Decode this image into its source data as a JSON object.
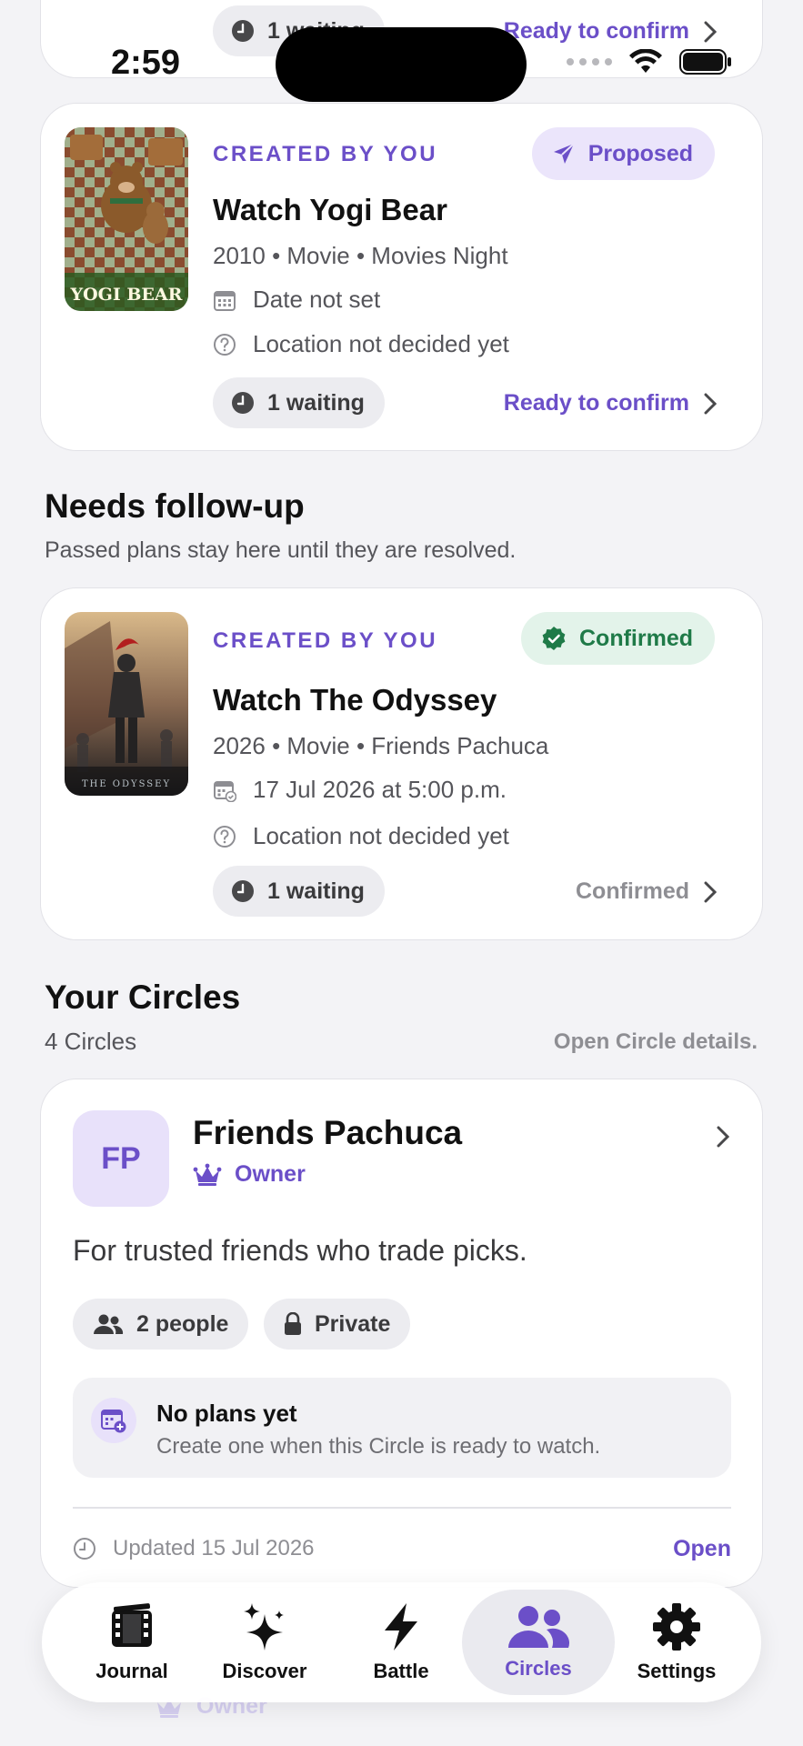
{
  "status_bar": {
    "time": "2:59"
  },
  "top_partial_card": {
    "waiting": "1 waiting",
    "action": "Ready to confirm"
  },
  "plan_yogi": {
    "created": "CREATED BY YOU",
    "status": "Proposed",
    "title": "Watch Yogi Bear",
    "meta": "2010 • Movie • Movies Night",
    "date": "Date not set",
    "location": "Location not decided yet",
    "waiting": "1 waiting",
    "action": "Ready to confirm",
    "poster_text": "YOGI BEAR"
  },
  "followup": {
    "title": "Needs follow-up",
    "subtitle": "Passed plans stay here until they are resolved."
  },
  "plan_odyssey": {
    "created": "CREATED BY YOU",
    "status": "Confirmed",
    "title": "Watch The Odyssey",
    "meta": "2026 • Movie • Friends Pachuca",
    "date": "17 Jul 2026 at 5:00 p.m.",
    "location": "Location not decided yet",
    "waiting": "1 waiting",
    "action": "Confirmed",
    "poster_text": "THE ODYSSEY"
  },
  "circles": {
    "title": "Your Circles",
    "count": "4 Circles",
    "hint": "Open Circle details.",
    "card": {
      "initials": "FP",
      "name": "Friends Pachuca",
      "role": "Owner",
      "description": "For trusted friends who trade picks.",
      "people": "2 people",
      "privacy": "Private",
      "noplans_title": "No plans yet",
      "noplans_sub": "Create one when this Circle is ready to watch.",
      "updated": "Updated 15 Jul 2026",
      "open": "Open"
    },
    "next_role": "Owner"
  },
  "tabs": [
    {
      "label": "Journal",
      "icon": "film-icon"
    },
    {
      "label": "Discover",
      "icon": "sparkles-icon"
    },
    {
      "label": "Battle",
      "icon": "bolt-icon"
    },
    {
      "label": "Circles",
      "icon": "people-icon",
      "active": true
    },
    {
      "label": "Settings",
      "icon": "gear-icon"
    }
  ],
  "colors": {
    "accent": "#6b4fc8",
    "confirmed": "#1f7a48",
    "background": "#f3f3f6"
  }
}
